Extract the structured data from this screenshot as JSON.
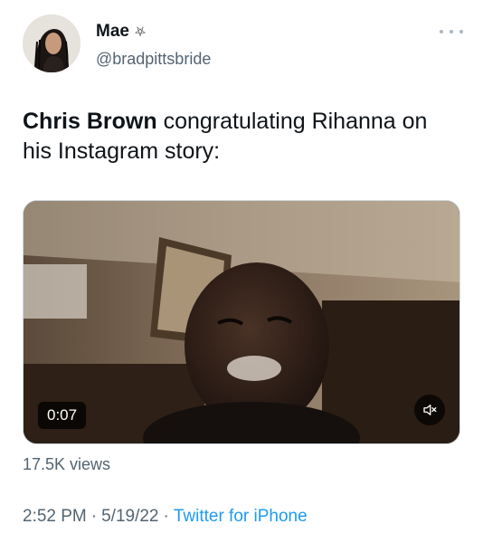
{
  "author": {
    "display_name": "Mae",
    "name_emoji": "⛧",
    "handle": "@bradpittsbride"
  },
  "tweet": {
    "text_bold": "Chris Brown",
    "text_rest": " congratulating Rihanna on his Instagram story:"
  },
  "video": {
    "time": "0:07",
    "mute_icon": "speaker-muted-icon"
  },
  "stats": {
    "views": "17.5K views"
  },
  "meta": {
    "time": "2:52 PM",
    "sep1": "·",
    "date": "5/19/22",
    "sep2": "·",
    "source": "Twitter for iPhone"
  },
  "colors": {
    "text_primary": "#0f1419",
    "text_secondary": "#536471",
    "link": "#1d9bf0"
  }
}
